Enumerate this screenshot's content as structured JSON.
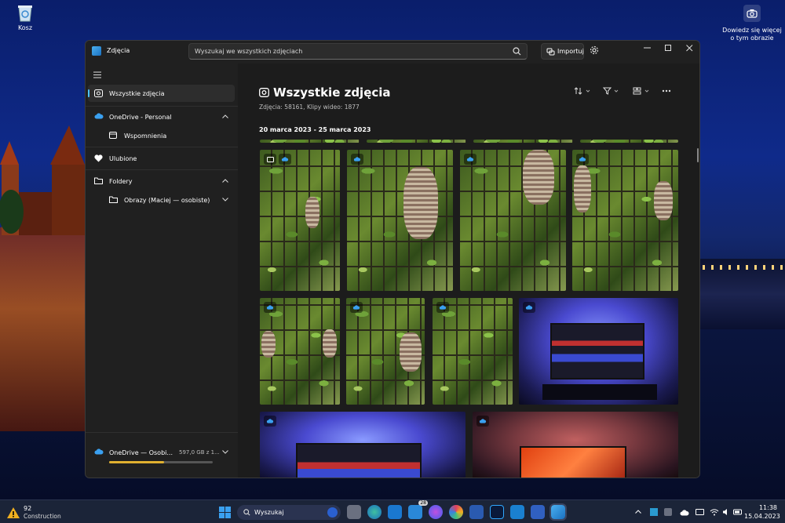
{
  "desktop": {
    "recycle_bin": "Kosz",
    "learn_more_line1": "Dowiedz się więcej",
    "learn_more_line2": "o tym obrazie"
  },
  "window": {
    "app_title": "Zdjęcia",
    "search_placeholder": "Wyszukaj we wszystkich zdjęciach",
    "import_label": "Importuj"
  },
  "sidebar": {
    "items": [
      {
        "label": "Wszystkie zdjęcia",
        "icon": "photos-icon"
      },
      {
        "label": "OneDrive - Personal",
        "icon": "cloud-icon"
      },
      {
        "label": "Wspomnienia",
        "icon": "album-icon"
      },
      {
        "label": "Ulubione",
        "icon": "heart-icon"
      },
      {
        "label": "Foldery",
        "icon": "folder-icon"
      },
      {
        "label": "Obrazy (Maciej — osobiste)",
        "icon": "folder-icon"
      }
    ],
    "storage": {
      "label": "OneDrive — Osobi...",
      "size": "597,0 GB z 1..."
    }
  },
  "main": {
    "title": "Wszystkie zdjęcia",
    "subtitle": "Zdjęcia: 58161, Klipy wideo: 1877",
    "date_group": "20 marca 2023 - 25 marca 2023"
  },
  "taskbar": {
    "weather_temp": "92",
    "weather_desc": "Construction",
    "search_label": "Wyszukaj",
    "badge_count": "28",
    "time": "11:38",
    "date": "15.04.2023"
  },
  "colors": {
    "accent": "#4cc2ff",
    "storage": "#e0b030"
  }
}
